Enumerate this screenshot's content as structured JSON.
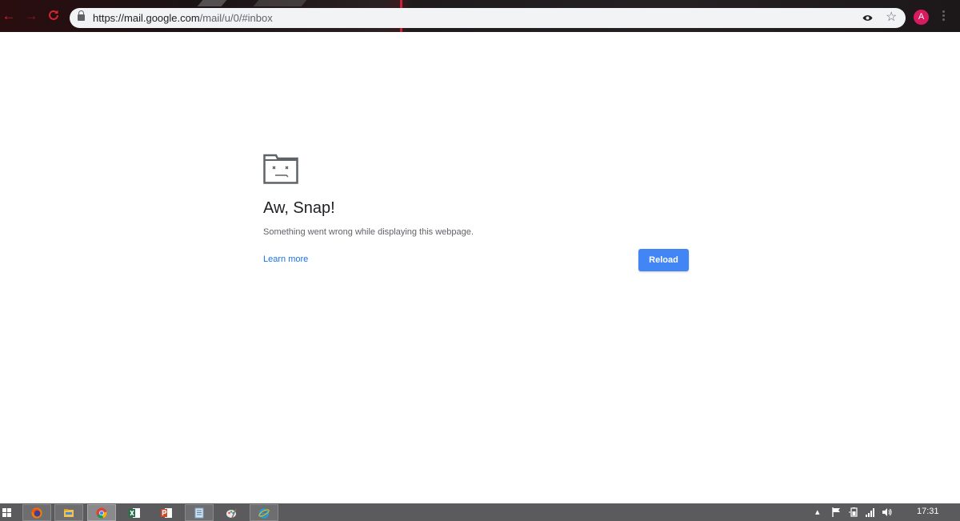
{
  "browser": {
    "url_host": "https://mail.google.com",
    "url_path": "/mail/u/0/#inbox",
    "profile_initial": "A",
    "accent_color": "#d8232e"
  },
  "error_page": {
    "title": "Aw, Snap!",
    "description": "Something went wrong while displaying this webpage.",
    "learn_more": "Learn more",
    "reload_label": "Reload",
    "button_color": "#4285f4"
  },
  "taskbar": {
    "apps": [
      {
        "name": "firefox-icon"
      },
      {
        "name": "file-explorer-icon"
      },
      {
        "name": "chrome-icon",
        "active": true
      },
      {
        "name": "excel-icon"
      },
      {
        "name": "powerpoint-icon"
      },
      {
        "name": "notepad-icon"
      },
      {
        "name": "paint-icon"
      },
      {
        "name": "internet-explorer-icon"
      }
    ],
    "tray": {
      "icons": [
        "chevron-up-icon",
        "flag-icon",
        "battery-icon",
        "signal-icon",
        "volume-icon"
      ],
      "clock": "17:31"
    }
  }
}
